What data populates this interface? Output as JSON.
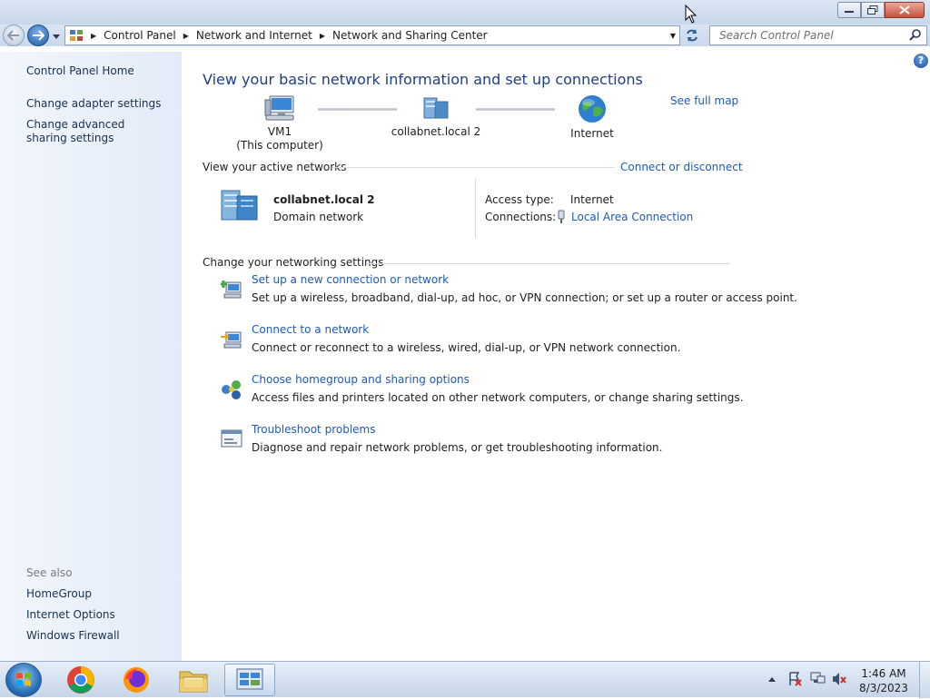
{
  "window": {
    "controls": [
      "minimize",
      "maximize",
      "close"
    ]
  },
  "navbar": {
    "breadcrumbs": [
      {
        "label": "Control Panel"
      },
      {
        "label": "Network and Internet"
      },
      {
        "label": "Network and Sharing Center"
      }
    ],
    "search_placeholder": "Search Control Panel"
  },
  "sidebar": {
    "home": "Control Panel Home",
    "links": [
      {
        "label": "Change adapter settings"
      },
      {
        "label": "Change advanced sharing settings"
      }
    ],
    "see_also_label": "See also",
    "see_also": [
      {
        "label": "HomeGroup"
      },
      {
        "label": "Internet Options"
      },
      {
        "label": "Windows Firewall"
      }
    ]
  },
  "main": {
    "heading": "View your basic network information and set up connections",
    "see_full_map": "See full map",
    "map": {
      "computer_name": "VM1",
      "computer_sub": "(This computer)",
      "network": "collabnet.local  2",
      "internet": "Internet"
    },
    "active_networks": {
      "title": "View your active networks",
      "action": "Connect or disconnect",
      "network_name": "collabnet.local  2",
      "network_type": "Domain network",
      "access_type_label": "Access type:",
      "access_type_value": "Internet",
      "connections_label": "Connections:",
      "connections_value": "Local Area Connection"
    },
    "settings": {
      "title": "Change your networking settings",
      "tasks": [
        {
          "title": "Set up a new connection or network",
          "desc": "Set up a wireless, broadband, dial-up, ad hoc, or VPN connection; or set up a router or access point."
        },
        {
          "title": "Connect to a network",
          "desc": "Connect or reconnect to a wireless, wired, dial-up, or VPN network connection."
        },
        {
          "title": "Choose homegroup and sharing options",
          "desc": "Access files and printers located on other network computers, or change sharing settings."
        },
        {
          "title": "Troubleshoot problems",
          "desc": "Diagnose and repair network problems, or get troubleshooting information."
        }
      ]
    }
  },
  "taskbar": {
    "apps": [
      "start",
      "chrome",
      "firefox",
      "explorer",
      "control-panel"
    ],
    "time": "1:46 AM",
    "date": "8/3/2023"
  }
}
